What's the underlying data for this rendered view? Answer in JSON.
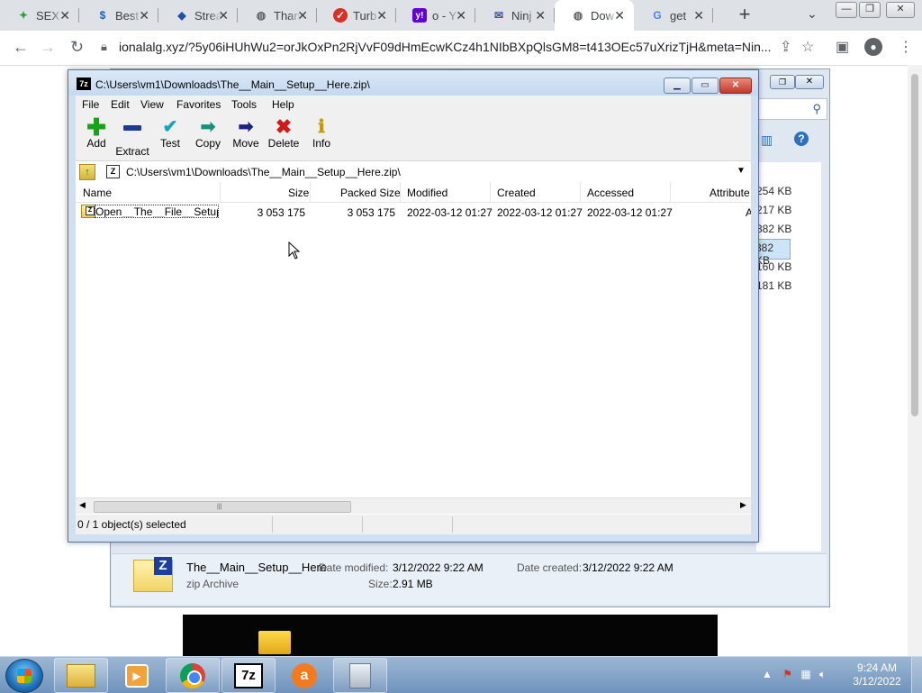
{
  "browser": {
    "tabs": [
      {
        "title": "SEX",
        "icon": "leaf-icon",
        "color": "#2e9e3f"
      },
      {
        "title": "Best",
        "icon": "dollar-icon",
        "color": "#1a5fb4"
      },
      {
        "title": "Strea",
        "icon": "shield-icon",
        "color": "#1e4fa3"
      },
      {
        "title": "Than",
        "icon": "globe-icon",
        "color": "#5f6368"
      },
      {
        "title": "Turb",
        "icon": "check-icon",
        "color": "#d93025"
      },
      {
        "title": "o - Y",
        "icon": "yahoo-icon",
        "color": "#6001d2"
      },
      {
        "title": "Ninj",
        "icon": "mail-icon",
        "color": "#3b5998"
      },
      {
        "title": "Dow",
        "icon": "globe-icon",
        "color": "#5f6368",
        "active": true
      },
      {
        "title": "get",
        "icon": "google-icon",
        "color": "#4285f4"
      }
    ],
    "url": "ionalalg.xyz/?5y06iHUhWu2=orJkOxPn2RjVvF09dHmEcwKCz4h1NIbBXpQlsGM8=t413OEc57uXrizTjH&meta=Nin..."
  },
  "explorer_bg": {
    "sizes": [
      "254 KB",
      "217 KB",
      "382 KB",
      "382 KB",
      "160 KB",
      "181 KB"
    ],
    "details": {
      "filename": "The__Main__Setup__Here",
      "type": "zip Archive",
      "date_modified_label": "Date modified:",
      "date_modified": "3/12/2022 9:22 AM",
      "date_created_label": "Date created:",
      "date_created": "3/12/2022 9:22 AM",
      "size_label": "Size:",
      "size": "2.91 MB"
    }
  },
  "zip": {
    "title": "C:\\Users\\vm1\\Downloads\\The__Main__Setup__Here.zip\\",
    "logo": "7z",
    "menu": [
      "File",
      "Edit",
      "View",
      "Favorites",
      "Tools",
      "Help"
    ],
    "toolbar": [
      {
        "label": "Add",
        "icon": "plus-icon",
        "color": "#19a11a"
      },
      {
        "label": "Extract",
        "icon": "minus-icon",
        "color": "#1f3a93"
      },
      {
        "label": "Test",
        "icon": "check-icon",
        "color": "#17a3b8"
      },
      {
        "label": "Copy",
        "icon": "copy-arrow-icon",
        "color": "#1a8f7a"
      },
      {
        "label": "Move",
        "icon": "move-arrow-icon",
        "color": "#1a237e"
      },
      {
        "label": "Delete",
        "icon": "x-icon",
        "color": "#d11a1a"
      },
      {
        "label": "Info",
        "icon": "info-icon",
        "color": "#c79a00"
      }
    ],
    "path": "C:\\Users\\vm1\\Downloads\\The__Main__Setup__Here.zip\\",
    "columns": [
      "Name",
      "Size",
      "Packed Size",
      "Modified",
      "Created",
      "Accessed",
      "Attribute"
    ],
    "rows": [
      {
        "name": "Open__The__File__Setup...",
        "size": "3 053 175",
        "packed": "3 053 175",
        "modified": "2022-03-12 01:27",
        "created": "2022-03-12 01:27",
        "accessed": "2022-03-12 01:27",
        "attr": "A"
      }
    ],
    "status": "0 / 1 object(s) selected"
  },
  "taskbar": {
    "apps": [
      "explorer-icon",
      "media-player-icon",
      "chrome-icon",
      "7zip-icon",
      "avast-icon",
      "documents-icon"
    ],
    "app_7z_label": "7z",
    "time": "9:24 AM",
    "date": "3/12/2022"
  }
}
